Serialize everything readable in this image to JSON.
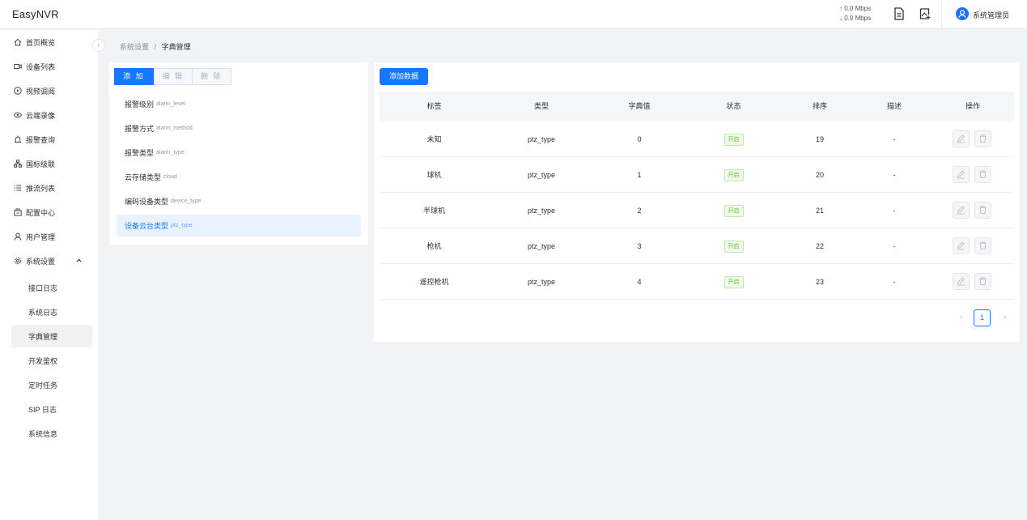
{
  "app": {
    "title": "EasyNVR"
  },
  "header": {
    "upload_rate": "↑ 0.0 Mbps",
    "download_rate": "↓ 0.0 Mbps",
    "user_name": "系统管理员"
  },
  "sidebar": {
    "collapse_icon": "chevron-left-icon",
    "items": [
      {
        "label": "首页概览",
        "icon": "home-icon"
      },
      {
        "label": "设备列表",
        "icon": "video-device-icon"
      },
      {
        "label": "视频调阅",
        "icon": "play-circle-icon"
      },
      {
        "label": "云端录像",
        "icon": "cloud-record-icon"
      },
      {
        "label": "报警查询",
        "icon": "alarm-icon"
      },
      {
        "label": "国标级联",
        "icon": "cascade-icon"
      },
      {
        "label": "推流列表",
        "icon": "list-icon"
      },
      {
        "label": "配置中心",
        "icon": "config-icon"
      },
      {
        "label": "用户管理",
        "icon": "user-icon"
      },
      {
        "label": "系统设置",
        "icon": "gear-icon"
      }
    ],
    "sub_items": [
      {
        "label": "接口日志"
      },
      {
        "label": "系统日志"
      },
      {
        "label": "字典管理",
        "active": true
      },
      {
        "label": "开发鉴权"
      },
      {
        "label": "定时任务"
      },
      {
        "label": "SIP 日志"
      },
      {
        "label": "系统信息"
      }
    ]
  },
  "breadcrumb": {
    "parent": "系统设置",
    "separator": "/",
    "current": "字典管理"
  },
  "dict_panel": {
    "buttons": {
      "add": "添 加",
      "edit": "编 辑",
      "delete": "删 除"
    },
    "types": [
      {
        "name": "报警级别",
        "code": "alarm_level"
      },
      {
        "name": "报警方式",
        "code": "alarm_method"
      },
      {
        "name": "报警类型",
        "code": "alarm_type"
      },
      {
        "name": "云存储类型",
        "code": "cloud"
      },
      {
        "name": "编码设备类型",
        "code": "device_type"
      },
      {
        "name": "设备云台类型",
        "code": "ptz_type",
        "active": true
      }
    ]
  },
  "data_panel": {
    "add_button": "添加数据",
    "columns": [
      "标签",
      "类型",
      "字典值",
      "状态",
      "排序",
      "描述",
      "操作"
    ],
    "rows": [
      {
        "label": "未知",
        "type": "ptz_type",
        "value": "0",
        "status": "开启",
        "order": "19",
        "desc": "-"
      },
      {
        "label": "球机",
        "type": "ptz_type",
        "value": "1",
        "status": "开启",
        "order": "20",
        "desc": "-"
      },
      {
        "label": "半球机",
        "type": "ptz_type",
        "value": "2",
        "status": "开启",
        "order": "21",
        "desc": "-"
      },
      {
        "label": "枪机",
        "type": "ptz_type",
        "value": "3",
        "status": "开启",
        "order": "22",
        "desc": "-"
      },
      {
        "label": "遥控枪机",
        "type": "ptz_type",
        "value": "4",
        "status": "开启",
        "order": "23",
        "desc": "-"
      }
    ],
    "pagination": {
      "prev": "‹",
      "page": "1",
      "next": "›"
    }
  },
  "colors": {
    "accent": "#1677ff",
    "status_green": "#67c23a",
    "page_bg": "#f2f3f5"
  }
}
